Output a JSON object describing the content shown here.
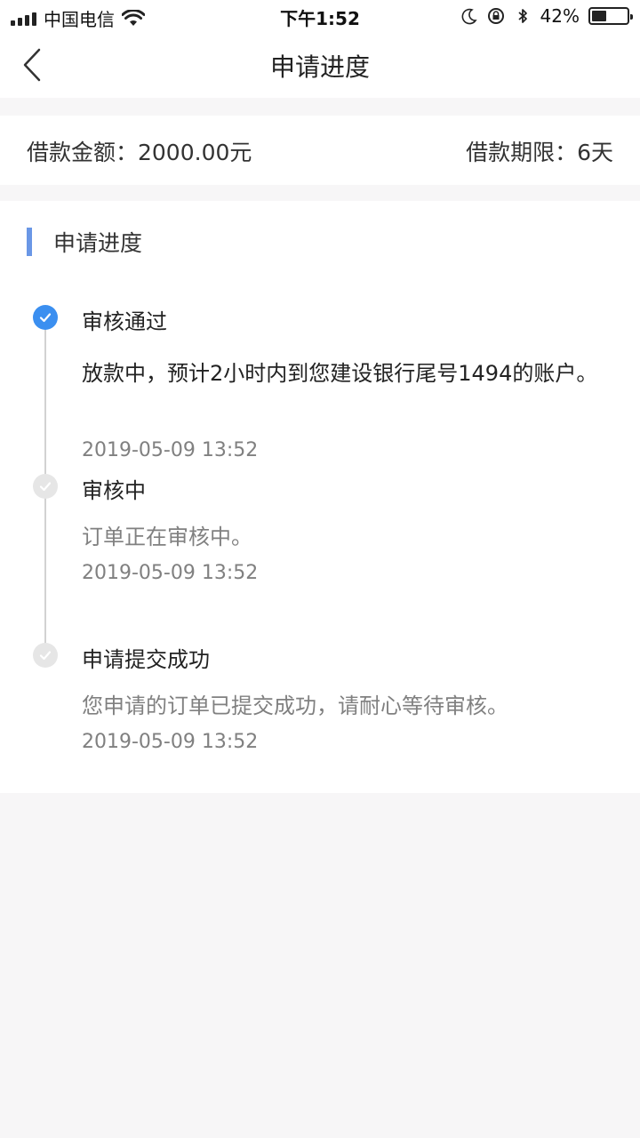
{
  "status_bar": {
    "carrier": "中国电信",
    "time": "下午1:52",
    "battery": "42%",
    "battery_level": 0.42,
    "icons": [
      "signal-icon",
      "wifi-icon",
      "moon-icon",
      "rotation-lock-icon",
      "bluetooth-icon",
      "battery-icon"
    ]
  },
  "nav": {
    "title": "申请进度",
    "back_icon": "chevron-left-icon"
  },
  "loan": {
    "amount": "借款金额：2000.00元",
    "term": "借款期限：6天"
  },
  "progress": {
    "title": "申请进度",
    "accent_color": "#6a97e6",
    "active_color": "#3b8ff0",
    "steps": [
      {
        "title": "审核通过",
        "desc": "放款中，预计2小时内到您建设银行尾号1494的账户。",
        "time": "2019-05-09 13:52",
        "state": "active"
      },
      {
        "title": "审核中",
        "desc": "订单正在审核中。",
        "time": "2019-05-09 13:52",
        "state": "inactive"
      },
      {
        "title": "申请提交成功",
        "desc": "您申请的订单已提交成功，请耐心等待审核。",
        "time": "2019-05-09 13:52",
        "state": "inactive"
      }
    ]
  }
}
